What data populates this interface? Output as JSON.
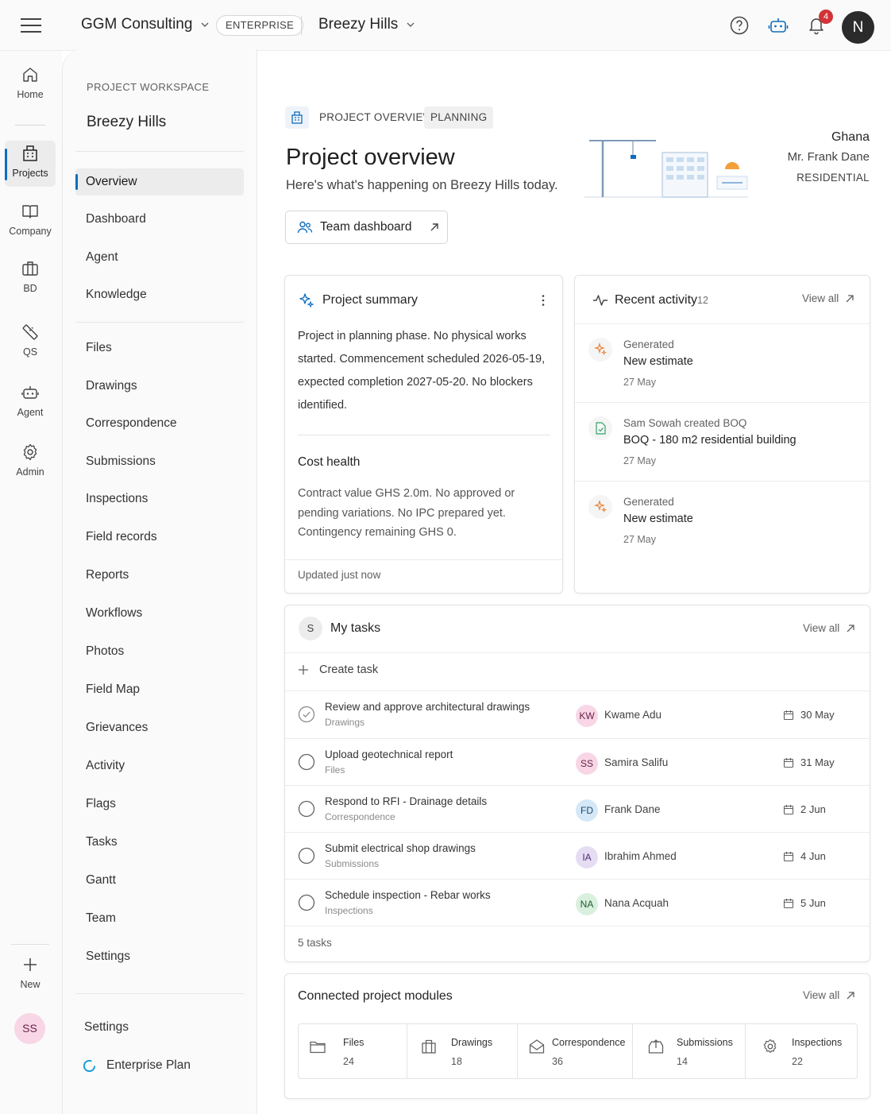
{
  "header": {
    "org_name": "GGM Consulting",
    "plan_badge": "ENTERPRISE",
    "project_name": "Breezy Hills",
    "notification_count": "4",
    "user_initial": "N"
  },
  "rail": {
    "items": [
      {
        "label": "Home",
        "icon": "home-icon"
      },
      {
        "label": "Projects",
        "icon": "building-icon"
      },
      {
        "label": "Company",
        "icon": "book-icon"
      },
      {
        "label": "BD",
        "icon": "briefcase-icon"
      },
      {
        "label": "QS",
        "icon": "ruler-icon"
      },
      {
        "label": "Agent",
        "icon": "bot-icon"
      },
      {
        "label": "Admin",
        "icon": "gear-icon"
      }
    ],
    "new_label": "New",
    "user_initials": "SS"
  },
  "sidenav": {
    "eyebrow": "PROJECT WORKSPACE",
    "title": "Breezy Hills",
    "group1": [
      "Overview",
      "Dashboard",
      "Agent",
      "Knowledge"
    ],
    "group2": [
      "Files",
      "Drawings",
      "Correspondence",
      "Submissions",
      "Inspections",
      "Field records",
      "Reports",
      "Workflows",
      "Photos",
      "Field Map",
      "Grievances",
      "Activity",
      "Flags",
      "Tasks",
      "Gantt",
      "Team",
      "Settings"
    ],
    "footer_settings": "Settings",
    "footer_plan": "Enterprise Plan"
  },
  "main": {
    "breadcrumb": "PROJECT OVERVIEW",
    "phase_badge": "PLANNING",
    "title": "Project overview",
    "subtitle": "Here's what's happening on Breezy Hills today.",
    "team_button": "Team dashboard",
    "meta": {
      "country": "Ghana",
      "client": "Mr. Frank Dane",
      "type": "RESIDENTIAL"
    }
  },
  "summary": {
    "title": "Project summary",
    "body": "Project in planning phase. No physical works started. Commencement scheduled 2026-05-19, expected completion 2027-05-20. No blockers identified.",
    "cost_title": "Cost health",
    "cost_body": "Contract value GHS 2.0m. No approved or pending variations. No IPC prepared yet. Contingency remaining GHS 0.",
    "footer": "Updated just now"
  },
  "activity": {
    "title": "Recent activity",
    "count": "12",
    "view_all": "View all",
    "items": [
      {
        "actor": "Generated",
        "detail": "New estimate",
        "date": "27 May",
        "color": "#e8833a"
      },
      {
        "actor": "Sam Sowah created BOQ",
        "detail": "BOQ - 180 m2 residential building",
        "date": "27 May",
        "color": "#2fa36b"
      },
      {
        "actor": "Generated",
        "detail": "New estimate",
        "date": "27 May",
        "color": "#e8833a"
      }
    ]
  },
  "tasks": {
    "title": "My tasks",
    "avatar": "S",
    "view_all": "View all",
    "create_label": "Create task",
    "footer": "5 tasks",
    "items": [
      {
        "title": "Review and approve architectural drawings",
        "category": "Drawings",
        "initials": "KW",
        "assignee": "Kwame Adu",
        "due": "30 May",
        "done": true,
        "bg": "#f8d6e6",
        "fg": "#6b2148"
      },
      {
        "title": "Upload geotechnical report",
        "category": "Files",
        "initials": "SS",
        "assignee": "Samira Salifu",
        "due": "31 May",
        "done": false,
        "bg": "#f8d6e6",
        "fg": "#6b2148"
      },
      {
        "title": "Respond to RFI - Drainage details",
        "category": "Correspondence",
        "initials": "FD",
        "assignee": "Frank Dane",
        "due": "2 Jun",
        "done": false,
        "bg": "#d4e8f7",
        "fg": "#1b4b72"
      },
      {
        "title": "Submit electrical shop drawings",
        "category": "Submissions",
        "initials": "IA",
        "assignee": "Ibrahim Ahmed",
        "due": "4 Jun",
        "done": false,
        "bg": "#e6dcf3",
        "fg": "#4b2c74"
      },
      {
        "title": "Schedule inspection - Rebar works",
        "category": "Inspections",
        "initials": "NA",
        "assignee": "Nana Acquah",
        "due": "5 Jun",
        "done": false,
        "bg": "#d9f0de",
        "fg": "#215a32"
      }
    ]
  },
  "modules": {
    "title": "Connected project modules",
    "view_all": "View all",
    "items": [
      {
        "name": "Files",
        "count": "24",
        "icon": "folder-icon"
      },
      {
        "name": "Drawings",
        "count": "18",
        "icon": "drawings-icon"
      },
      {
        "name": "Correspondence",
        "count": "36",
        "icon": "envelope-icon"
      },
      {
        "name": "Submissions",
        "count": "14",
        "icon": "tray-icon"
      },
      {
        "name": "Inspections",
        "count": "22",
        "icon": "gear-icon"
      }
    ]
  }
}
